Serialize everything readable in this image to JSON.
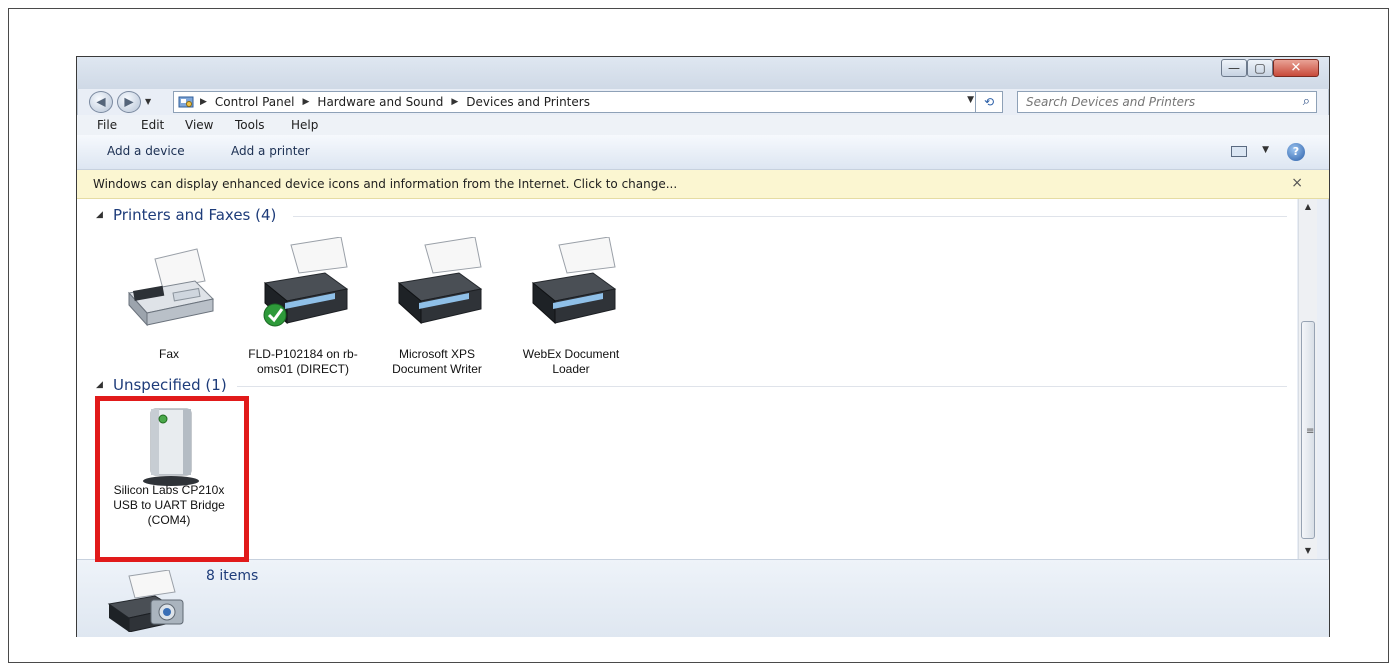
{
  "window": {
    "caption_buttons": {
      "minimize": "—",
      "maximize": "▢",
      "close": "✕"
    }
  },
  "nav": {
    "back_icon": "◀",
    "forward_icon": "▶",
    "breadcrumbs": [
      "Control Panel",
      "Hardware and Sound",
      "Devices and Printers"
    ],
    "refresh_icon": "⟲",
    "search_placeholder": "Search Devices and Printers"
  },
  "menu": [
    "File",
    "Edit",
    "View",
    "Tools",
    "Help"
  ],
  "commands": {
    "add_device": "Add a device",
    "add_printer": "Add a printer",
    "help": "?"
  },
  "infobar": {
    "message": "Windows can display enhanced device icons and information from the Internet. Click to change...",
    "close": "×"
  },
  "groups": {
    "printers": {
      "header": "Printers and Faxes (4)",
      "items": [
        {
          "label": "Fax",
          "icon": "fax-machine-icon"
        },
        {
          "label": "FLD-P102184 on rb-oms01 (DIRECT)",
          "icon": "printer-icon",
          "default": true
        },
        {
          "label": "Microsoft XPS Document Writer",
          "icon": "printer-icon"
        },
        {
          "label": "WebEx Document Loader",
          "icon": "printer-icon"
        }
      ]
    },
    "unspecified": {
      "header": "Unspecified (1)",
      "items": [
        {
          "label": "Silicon Labs CP210x USB to UART Bridge (COM4)",
          "icon": "generic-device-icon"
        }
      ]
    }
  },
  "details": {
    "count": "8 items"
  },
  "colors": {
    "highlight": "#e11a1a",
    "group_header": "#1e3c7a",
    "infobar": "#fbf6d1"
  }
}
